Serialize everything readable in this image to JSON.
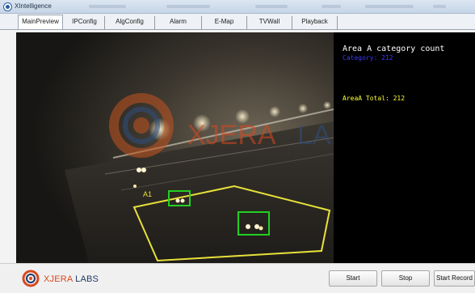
{
  "window": {
    "title": "XIntelligence"
  },
  "tabs": [
    {
      "label": "MainPreview",
      "active": true
    },
    {
      "label": "IPConfig",
      "active": false
    },
    {
      "label": "AlgConfig",
      "active": false
    },
    {
      "label": "Alarm",
      "active": false
    },
    {
      "label": "E-Map",
      "active": false
    },
    {
      "label": "TVWall",
      "active": false
    },
    {
      "label": "Playback",
      "active": false
    }
  ],
  "video": {
    "watermark_brand": "XJERA",
    "watermark_suffix": "LABS",
    "zone_label": "A1",
    "zone_color": "#e8e23a",
    "detection_color": "#22d022"
  },
  "info_panel": {
    "title": "Area A category count",
    "category_line": "Category: 212",
    "total_line": "AreaA Total: 212"
  },
  "footer": {
    "logo_brand": "XJERA",
    "logo_suffix": "LABS",
    "start_label": "Start",
    "stop_label": "Stop",
    "start_record_label": "Start Record"
  },
  "colors": {
    "accent": "#d9481f",
    "brand_dark": "#1f3a66",
    "info_title": "#ffffff",
    "info_category": "#3b3bff",
    "info_total": "#ffff33"
  }
}
